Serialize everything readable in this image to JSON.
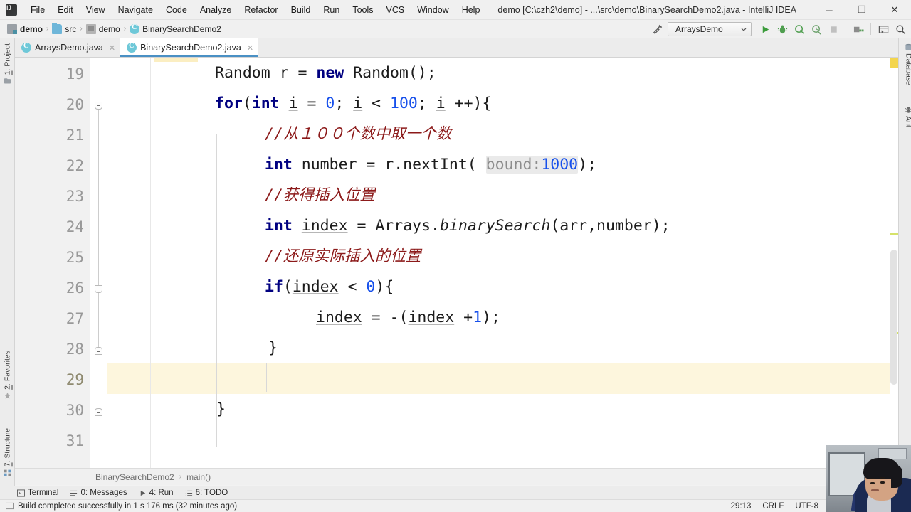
{
  "window": {
    "title": "demo [C:\\czh2\\demo] - ...\\src\\demo\\BinarySearchDemo2.java - IntelliJ IDEA",
    "minimize": "─",
    "maximize": "❐",
    "close": "✕",
    "logo": "ij-logo"
  },
  "menubar": {
    "items": [
      {
        "pre": "",
        "mn": "F",
        "post": "ile"
      },
      {
        "pre": "",
        "mn": "E",
        "post": "dit"
      },
      {
        "pre": "",
        "mn": "V",
        "post": "iew"
      },
      {
        "pre": "",
        "mn": "N",
        "post": "avigate"
      },
      {
        "pre": "",
        "mn": "C",
        "post": "ode"
      },
      {
        "pre": "An",
        "mn": "a",
        "post": "lyze"
      },
      {
        "pre": "",
        "mn": "R",
        "post": "efactor"
      },
      {
        "pre": "",
        "mn": "B",
        "post": "uild"
      },
      {
        "pre": "R",
        "mn": "u",
        "post": "n"
      },
      {
        "pre": "",
        "mn": "T",
        "post": "ools"
      },
      {
        "pre": "VC",
        "mn": "S",
        "post": ""
      },
      {
        "pre": "",
        "mn": "W",
        "post": "indow"
      },
      {
        "pre": "",
        "mn": "H",
        "post": "elp"
      }
    ]
  },
  "breadcrumb": {
    "separator": "›",
    "items": [
      {
        "label": "demo",
        "icon": "module-icon",
        "bold": true
      },
      {
        "label": "src",
        "icon": "source-folder-icon",
        "bold": false
      },
      {
        "label": "demo",
        "icon": "package-folder-icon",
        "bold": false
      },
      {
        "label": "BinarySearchDemo2",
        "icon": "java-class-icon",
        "bold": false
      }
    ]
  },
  "toolbar": {
    "build_icon": "hammer-icon",
    "run_config": "ArraysDemo",
    "run_config_chevron": "⌄",
    "buttons": [
      {
        "name": "run-button",
        "icon": "play-icon"
      },
      {
        "name": "debug-button",
        "icon": "bug-icon"
      },
      {
        "name": "run-with-coverage-button",
        "icon": "coverage-icon"
      },
      {
        "name": "profile-button",
        "icon": "profiler-icon"
      },
      {
        "name": "stop-button",
        "icon": "stop-icon"
      },
      {
        "name": "project-structure-button",
        "icon": "project-structure-icon"
      },
      {
        "name": "updates-button",
        "icon": "window-icon"
      },
      {
        "name": "search-everywhere-button",
        "icon": "search-icon"
      }
    ]
  },
  "left_strip": {
    "tabs": [
      {
        "num": "1",
        "label": ": Project",
        "icon": "project-icon"
      },
      {
        "num": "2",
        "label": ": Favorites",
        "icon": "star-icon"
      },
      {
        "num": "7",
        "label": ": Structure",
        "icon": "structure-icon"
      }
    ]
  },
  "right_strip": {
    "tabs": [
      {
        "label": "Database",
        "icon": "database-icon"
      },
      {
        "label": "Ant",
        "icon": "ant-icon"
      }
    ]
  },
  "editor_tabs": [
    {
      "label": "ArraysDemo.java",
      "icon": "java-class-icon",
      "active": false,
      "close": "✕"
    },
    {
      "label": "BinarySearchDemo2.java",
      "icon": "java-class-icon",
      "active": true,
      "close": "✕"
    }
  ],
  "editor": {
    "line_numbers": [
      "19",
      "20",
      "21",
      "22",
      "23",
      "24",
      "25",
      "26",
      "27",
      "28",
      "29",
      "30",
      "31"
    ],
    "current_line": "29",
    "lines": [
      {
        "n": "19",
        "text": "Random r = new Random();"
      },
      {
        "n": "20",
        "text": "for(int i = 0; i < 100; i ++){"
      },
      {
        "n": "21",
        "text": "//从１００个数中取一个数"
      },
      {
        "n": "22",
        "text": "int number = r.nextInt( bound: 1000);"
      },
      {
        "n": "23",
        "text": "//获得插入位置"
      },
      {
        "n": "24",
        "text": "int index = Arrays.binarySearch(arr,number);"
      },
      {
        "n": "25",
        "text": "//还原实际插入的位置"
      },
      {
        "n": "26",
        "text": "if(index < 0){"
      },
      {
        "n": "27",
        "text": "index = -(index +1);"
      },
      {
        "n": "28",
        "text": "}"
      },
      {
        "n": "29",
        "text": ""
      },
      {
        "n": "30",
        "text": "}"
      },
      {
        "n": "31",
        "text": ""
      }
    ],
    "tokens": {
      "l19": {
        "t1": "Random r = ",
        "kw": "new",
        "t2": " Random();"
      },
      "l20": {
        "kw": "for",
        "p1": "(",
        "kw2": "int",
        "v1": "i",
        "op1": " = ",
        "n1": "0",
        "op2": "; ",
        "v2": "i",
        "op3": " < ",
        "n2": "100",
        "op4": "; ",
        "v3": "i",
        "op5": " ++){"
      },
      "l21": {
        "cmt": "//从１００个数中取一个数"
      },
      "l22": {
        "kw": "int",
        "t1": " number = r.nextInt( ",
        "hint": "bound:",
        "n1": "1000",
        "t2": ");"
      },
      "l23": {
        "cmt": "//获得插入位置"
      },
      "l24": {
        "kw": "int",
        "sp": " ",
        "v": "index",
        "t1": " = Arrays.",
        "fn": "binarySearch",
        "t2": "(arr,number);"
      },
      "l25": {
        "cmt": "//还原实际插入的位置"
      },
      "l26": {
        "kw": "if",
        "t1": "(",
        "v": "index",
        "t2": " < ",
        "n": "0",
        "t3": "){"
      },
      "l27": {
        "v1": "index",
        "t1": " = -(",
        "v2": "index",
        "t2": " +",
        "n": "1",
        "t3": ");"
      },
      "l28": {
        "t1": "}"
      },
      "l30": {
        "t1": "}"
      }
    },
    "breadcrumb": {
      "class": "BinarySearchDemo2",
      "separator": "›",
      "method": "main()"
    }
  },
  "tool_window_bar": {
    "buttons": [
      {
        "num": "",
        "icon": "terminal-icon",
        "pre": "Terminal",
        "u": "",
        "post": ""
      },
      {
        "num": "0",
        "icon": "messages-icon",
        "pre": "",
        "u": "0",
        "post": ": Messages"
      },
      {
        "num": "4",
        "icon": "run-icon",
        "pre": "",
        "u": "4",
        "post": ": Run"
      },
      {
        "num": "6",
        "icon": "todo-icon",
        "pre": "",
        "u": "6",
        "post": ": TODO"
      }
    ]
  },
  "statusbar": {
    "icon": "build-status-icon",
    "message": "Build completed successfully in 1 s 176 ms (32 minutes ago)",
    "caret": "29:13",
    "line_separator": "CRLF",
    "encoding": "UTF-8"
  },
  "colors": {
    "keyword": "#000080",
    "number": "#1750eb",
    "comment": "#8c1a1a",
    "text": "#1c1c1c",
    "tab_accent": "#4a90c4",
    "current_line": "#fdf6dd",
    "warning_marker": "#f0e14a"
  }
}
